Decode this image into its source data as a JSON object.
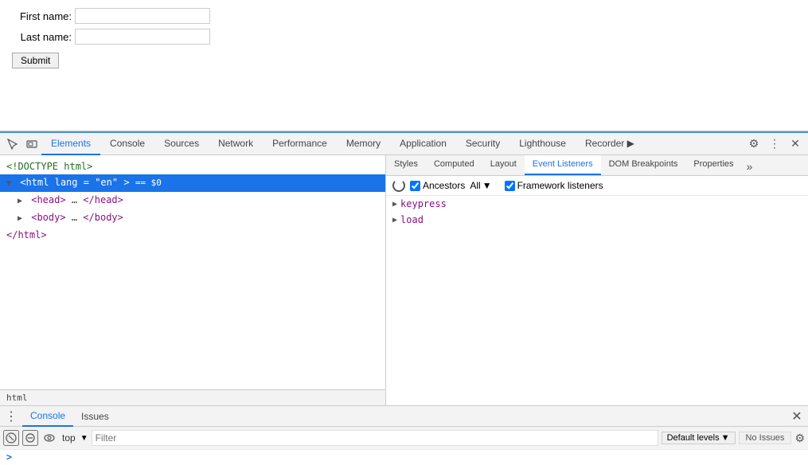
{
  "page": {
    "form": {
      "first_name_label": "First name:",
      "last_name_label": "Last name:",
      "submit_label": "Submit"
    }
  },
  "devtools": {
    "tabs": [
      {
        "label": "Elements",
        "active": true
      },
      {
        "label": "Console",
        "active": false
      },
      {
        "label": "Sources",
        "active": false
      },
      {
        "label": "Network",
        "active": false
      },
      {
        "label": "Performance",
        "active": false
      },
      {
        "label": "Memory",
        "active": false
      },
      {
        "label": "Application",
        "active": false
      },
      {
        "label": "Security",
        "active": false
      },
      {
        "label": "Lighthouse",
        "active": false
      },
      {
        "label": "Recorder ▶",
        "active": false
      }
    ],
    "dom": {
      "line1": "<!DOCTYPE html>",
      "line2_open": "<html ",
      "line2_attr_name": "lang",
      "line2_attr_eq": "=",
      "line2_attr_val": "\"en\"",
      "line2_rest": "> == $0",
      "line3": "<head>…</head>",
      "line4": "<body>…</body>",
      "line5": "</html>"
    },
    "breadcrumb": "html",
    "styles_tabs": [
      {
        "label": "Styles"
      },
      {
        "label": "Computed"
      },
      {
        "label": "Layout"
      },
      {
        "label": "Event Listeners",
        "active": true
      },
      {
        "label": "DOM Breakpoints"
      },
      {
        "label": "Properties"
      }
    ],
    "event_listeners": {
      "ancestors_label": "Ancestors",
      "all_label": "All",
      "framework_label": "Framework listeners",
      "events": [
        {
          "name": "keypress"
        },
        {
          "name": "load"
        }
      ]
    },
    "console": {
      "tabs": [
        {
          "label": "Console",
          "active": true
        },
        {
          "label": "Issues"
        }
      ],
      "filter_placeholder": "Filter",
      "default_levels": "Default levels",
      "no_issues": "No Issues",
      "prompt": ">"
    }
  }
}
